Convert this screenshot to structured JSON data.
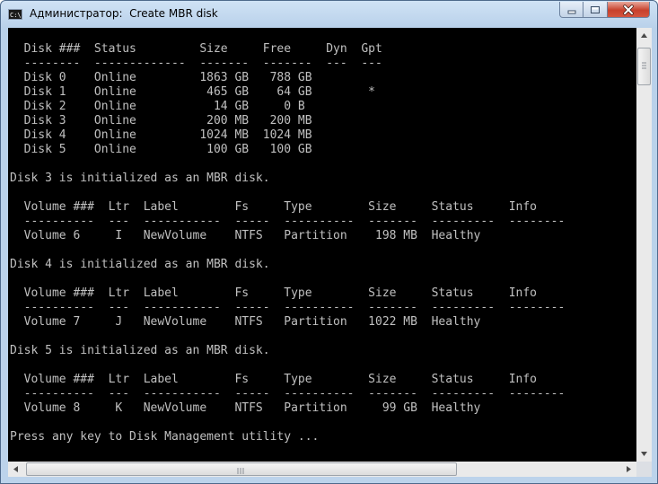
{
  "window": {
    "title": "Администратор:  Create MBR disk",
    "app_icon_text": "C:\\"
  },
  "console_lines": [
    "  Disk ###  Status         Size     Free     Dyn  Gpt",
    "  --------  -------------  -------  -------  ---  ---",
    "  Disk 0    Online         1863 GB   788 GB",
    "  Disk 1    Online          465 GB    64 GB        *",
    "  Disk 2    Online           14 GB     0 B",
    "  Disk 3    Online          200 MB   200 MB",
    "  Disk 4    Online         1024 MB  1024 MB",
    "  Disk 5    Online          100 GB   100 GB",
    "",
    "Disk 3 is initialized as an MBR disk.",
    "",
    "  Volume ###  Ltr  Label        Fs     Type        Size     Status     Info",
    "  ----------  ---  -----------  -----  ----------  -------  ---------  --------",
    "  Volume 6     I   NewVolume    NTFS   Partition    198 MB  Healthy",
    "",
    "Disk 4 is initialized as an MBR disk.",
    "",
    "  Volume ###  Ltr  Label        Fs     Type        Size     Status     Info",
    "  ----------  ---  -----------  -----  ----------  -------  ---------  --------",
    "  Volume 7     J   NewVolume    NTFS   Partition   1022 MB  Healthy",
    "",
    "Disk 5 is initialized as an MBR disk.",
    "",
    "  Volume ###  Ltr  Label        Fs     Type        Size     Status     Info",
    "  ----------  ---  -----------  -----  ----------  -------  ---------  --------",
    "  Volume 8     K   NewVolume    NTFS   Partition     99 GB  Healthy",
    "",
    "Press any key to Disk Management utility ..."
  ],
  "colors": {
    "console_bg": "#000000",
    "console_fg": "#c0c0c0",
    "titlebar": "#b9d1ea",
    "close_button": "#c7402c"
  },
  "icons": {
    "app": "console-icon",
    "minimize": "minimize-icon",
    "maximize": "maximize-icon",
    "close": "close-icon",
    "scroll_up": "arrow-up-icon",
    "scroll_down": "arrow-down-icon",
    "scroll_left": "arrow-left-icon",
    "scroll_right": "arrow-right-icon"
  }
}
